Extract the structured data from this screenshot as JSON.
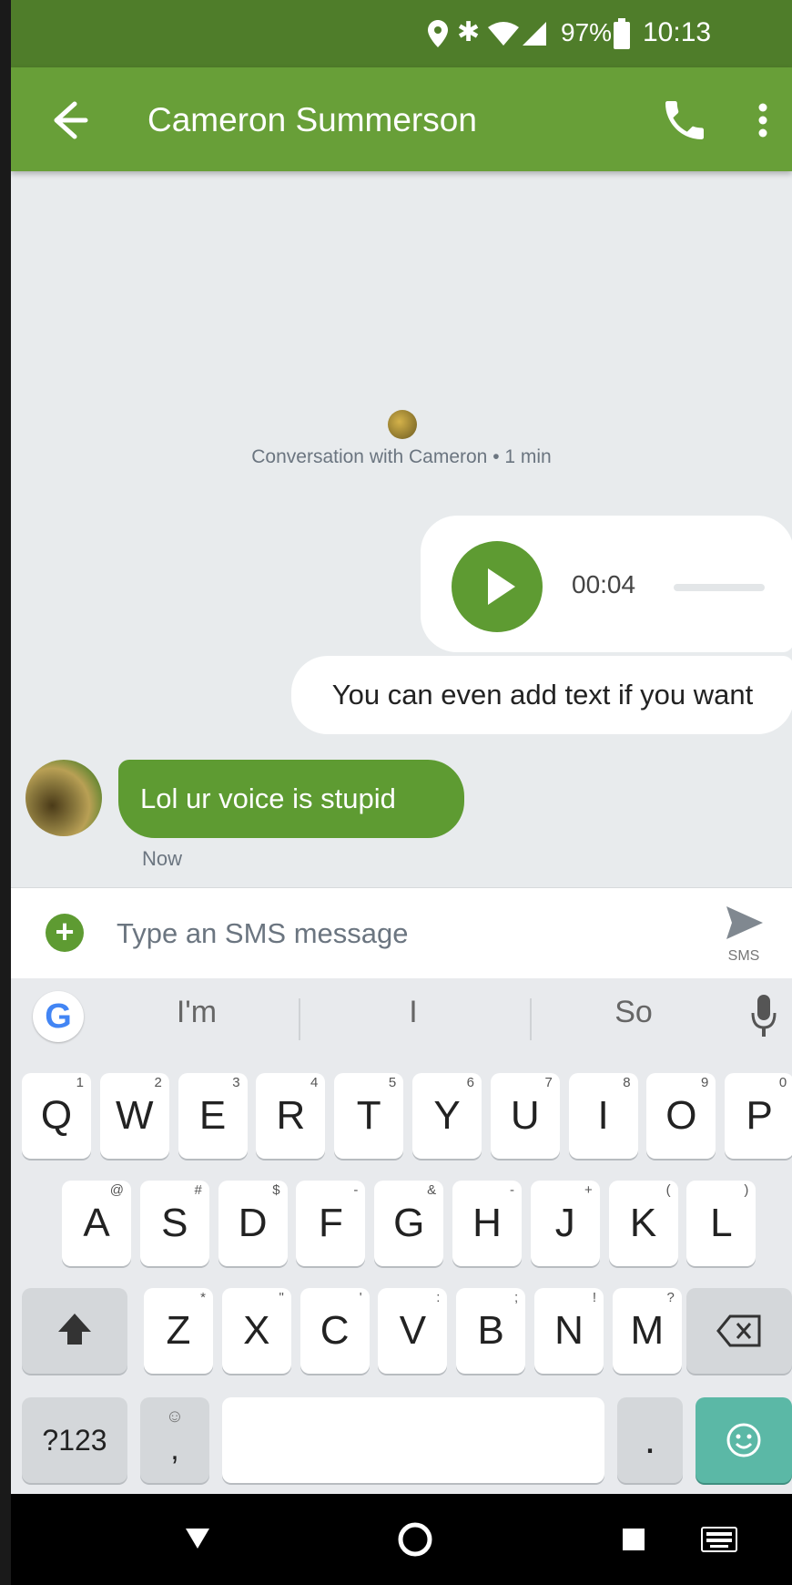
{
  "status_bar": {
    "battery": "97%",
    "time": "10:13"
  },
  "app_bar": {
    "title": "Cameron Summerson"
  },
  "conversation": {
    "info": "Conversation with Cameron • 1 min",
    "voice_message": {
      "duration": "00:04"
    },
    "outgoing_text": "You can even add text if you want",
    "incoming_text": "Lol ur voice is stupid",
    "incoming_time": "Now"
  },
  "composer": {
    "placeholder": "Type an SMS message",
    "send_label": "SMS"
  },
  "keyboard": {
    "suggestions": [
      "I'm",
      "I",
      "So"
    ],
    "row1": [
      {
        "k": "Q",
        "h": "1"
      },
      {
        "k": "W",
        "h": "2"
      },
      {
        "k": "E",
        "h": "3"
      },
      {
        "k": "R",
        "h": "4"
      },
      {
        "k": "T",
        "h": "5"
      },
      {
        "k": "Y",
        "h": "6"
      },
      {
        "k": "U",
        "h": "7"
      },
      {
        "k": "I",
        "h": "8"
      },
      {
        "k": "O",
        "h": "9"
      },
      {
        "k": "P",
        "h": "0"
      }
    ],
    "row2": [
      {
        "k": "A",
        "h": "@"
      },
      {
        "k": "S",
        "h": "#"
      },
      {
        "k": "D",
        "h": "$"
      },
      {
        "k": "F",
        "h": "-"
      },
      {
        "k": "G",
        "h": "&"
      },
      {
        "k": "H",
        "h": "-"
      },
      {
        "k": "J",
        "h": "+"
      },
      {
        "k": "K",
        "h": "("
      },
      {
        "k": "L",
        "h": ")"
      }
    ],
    "row3": [
      {
        "k": "Z",
        "h": "*"
      },
      {
        "k": "X",
        "h": "\""
      },
      {
        "k": "C",
        "h": "'"
      },
      {
        "k": "V",
        "h": ":"
      },
      {
        "k": "B",
        "h": ";"
      },
      {
        "k": "N",
        "h": "!"
      },
      {
        "k": "M",
        "h": "?"
      }
    ],
    "symbols_label": "?123",
    "comma_label": ",",
    "period_label": "."
  },
  "colors": {
    "app_bar": "#689f38",
    "status_bar": "#4f7d2a",
    "accent": "#5e9b32",
    "emoji_key": "#5bb8a6"
  }
}
